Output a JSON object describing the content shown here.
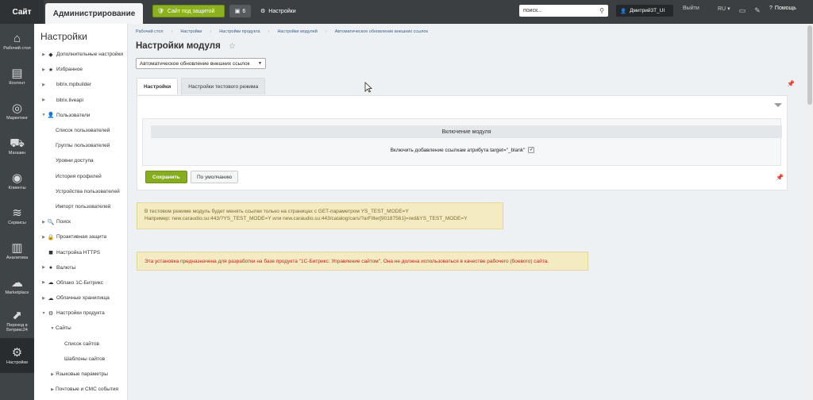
{
  "topbar": {
    "site_label": "Сайт",
    "admin_tab": "Администрирование",
    "protect_button": "Сайт под защитой",
    "counter": "6",
    "settings_label": "Настройки",
    "search_placeholder": "поиск...",
    "user_name": "Дмитрий3Т_UI",
    "logout_label": "Выйти",
    "lang_label": "RU",
    "help_label": "Помощь"
  },
  "left_nav": [
    {
      "label": "Рабочий стол",
      "icon": "home-icon"
    },
    {
      "label": "Контент",
      "icon": "document-icon"
    },
    {
      "label": "Маркетинг",
      "icon": "target-icon"
    },
    {
      "label": "Магазин",
      "icon": "cart-icon"
    },
    {
      "label": "Клиенты",
      "icon": "clients-24-icon"
    },
    {
      "label": "Сервисы",
      "icon": "layers-icon"
    },
    {
      "label": "Аналитика",
      "icon": "bar-chart-icon"
    },
    {
      "label": "Marketplace",
      "icon": "cloud-download-icon"
    },
    {
      "label": "Переход в Битрикс24",
      "icon": "bitrix24-icon"
    },
    {
      "label": "Настройки",
      "icon": "gear-icon"
    }
  ],
  "sidebar": {
    "title": "Настройки",
    "items": [
      {
        "label": "Дополнительные настройки",
        "level": 0,
        "arrow": "▶",
        "icon": "◆"
      },
      {
        "label": "Избранное",
        "level": 0,
        "arrow": "▶",
        "icon": "★"
      },
      {
        "label": "bitrix.mpbuilder",
        "level": 0,
        "arrow": "▶",
        "icon": ""
      },
      {
        "label": "bitrix.liveapi",
        "level": 0,
        "arrow": "▶",
        "icon": ""
      },
      {
        "label": "Пользователи",
        "level": 0,
        "arrow": "▼",
        "icon": "👤"
      },
      {
        "label": "Список пользователей",
        "level": 1,
        "arrow": "",
        "icon": ""
      },
      {
        "label": "Группы пользователей",
        "level": 1,
        "arrow": "",
        "icon": ""
      },
      {
        "label": "Уровни доступа",
        "level": 1,
        "arrow": "",
        "icon": ""
      },
      {
        "label": "История профилей",
        "level": 1,
        "arrow": "",
        "icon": ""
      },
      {
        "label": "Устройства пользователей",
        "level": 1,
        "arrow": "",
        "icon": ""
      },
      {
        "label": "Импорт пользователей",
        "level": 1,
        "arrow": "",
        "icon": ""
      },
      {
        "label": "Поиск",
        "level": 0,
        "arrow": "▶",
        "icon": "🔍"
      },
      {
        "label": "Проактивная защита",
        "level": 0,
        "arrow": "▶",
        "icon": "🔒"
      },
      {
        "label": "Настройка HTTPS",
        "level": 0,
        "arrow": "",
        "icon": "◼"
      },
      {
        "label": "Валюты",
        "level": 0,
        "arrow": "▶",
        "icon": "●"
      },
      {
        "label": "Облако 1С-Битрикс",
        "level": 0,
        "arrow": "▶",
        "icon": "☁"
      },
      {
        "label": "Облачные хранилища",
        "level": 0,
        "arrow": "▶",
        "icon": "☁"
      },
      {
        "label": "Настройки продукта",
        "level": 0,
        "arrow": "▼",
        "icon": "⚙"
      },
      {
        "label": "Сайты",
        "level": 1,
        "arrow": "▼",
        "icon": ""
      },
      {
        "label": "Список сайтов",
        "level": 2,
        "arrow": "",
        "icon": ""
      },
      {
        "label": "Шаблоны сайтов",
        "level": 2,
        "arrow": "",
        "icon": ""
      },
      {
        "label": "Языковые параметры",
        "level": 1,
        "arrow": "▶",
        "icon": ""
      },
      {
        "label": "Почтовые и СМС события",
        "level": 1,
        "arrow": "▶",
        "icon": ""
      }
    ]
  },
  "breadcrumbs": [
    "Рабочий стол",
    "Настройки",
    "Настройки продукта",
    "Настройки модулей",
    "Автоматическое обновление внешних ссылок"
  ],
  "page_title": "Настройки модуля",
  "module_select": "Автоматическое обновление внешних ссылок",
  "tabs": [
    "Настройки",
    "Настройки тестового режима"
  ],
  "section_header": "Включение модуля",
  "option_label": "Включить добавление ссылкам атрибута target=\"_blank\"",
  "option_checked": true,
  "buttons": {
    "save": "Сохранить",
    "default": "По умолчанию"
  },
  "notes": {
    "test_mode_line1": "В тестовом режиме модуль будет менять ссылки только на страницах с GET-параметром YS_TEST_MODE=Y",
    "test_mode_line2": "Например: new.caraudio.su:443/?YS_TEST_MODE=Y или new.caraudio.su:443/catalog/cars/?arFilter[90187561]=red&YS_TEST_MODE=Y",
    "warning": "Эта установка предназначена для разработки на базе продукта \"1С-Битрикс: Управление сайтом\". Она не должна использоваться в качестве рабочего (боевого) сайта."
  },
  "colors": {
    "accent_green": "#86ad1d",
    "topbar": "#3b3f42",
    "warning_text": "#c8201e"
  }
}
